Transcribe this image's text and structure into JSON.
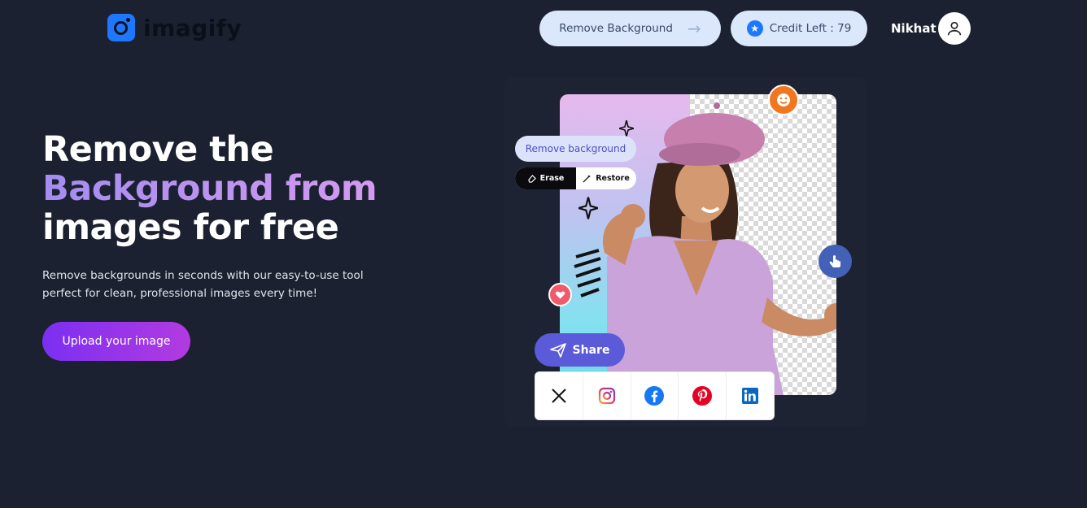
{
  "header": {
    "logo_text": "imagify",
    "remove_bg_label": "Remove Background",
    "credit_label": "Credit Left : 79",
    "username": "Nikhat"
  },
  "hero": {
    "title_line1": "Remove the",
    "title_line2": "Background from",
    "title_line3": "images for free",
    "subtitle_line1": "Remove backgrounds in seconds with our easy-to-use tool",
    "subtitle_line2": "perfect for clean, professional images every time!",
    "upload_label": "Upload your image"
  },
  "showcase": {
    "chip_label": "Remove background",
    "erase_label": "Erase",
    "restore_label": "Restore",
    "share_label": "Share",
    "socials": [
      "x-icon",
      "instagram-icon",
      "facebook-icon",
      "pinterest-icon",
      "linkedin-icon"
    ]
  },
  "colors": {
    "background": "#1b2130",
    "brand": "#1e78ff",
    "upload_gradient_start": "#7b2ff2",
    "upload_gradient_end": "#b23be0",
    "share": "#5b5ad8"
  }
}
